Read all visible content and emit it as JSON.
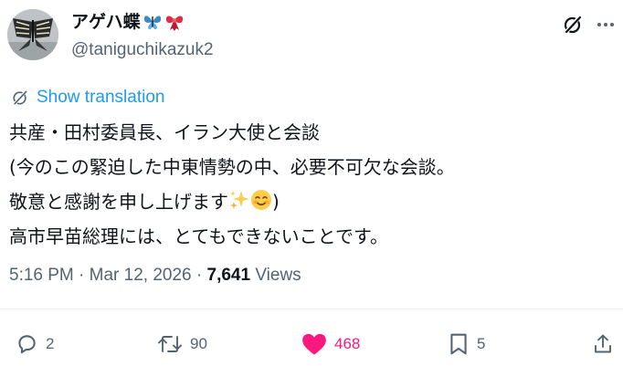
{
  "author": {
    "display_name": "アゲハ蝶",
    "name_emojis": [
      "butterfly-emoji",
      "ribbon-emoji"
    ],
    "handle": "@taniguchikazuk2"
  },
  "header_icons": [
    "grok-icon",
    "more-icon"
  ],
  "translation": {
    "label": "Show translation",
    "icon": "translate-icon"
  },
  "tweet": {
    "lines": [
      "共産・田村委員長、イラン大使と会談",
      "(今のこの緊迫した中東情勢の中、必要不可欠な会談。",
      "敬意と感謝を申し上げます",
      "高市早苗総理には、とてもできないことです。"
    ],
    "line3_emojis": [
      "sparkles-emoji",
      "smiling-face-emoji"
    ],
    "line3_suffix": ")"
  },
  "meta": {
    "time": "5:16 PM",
    "separator": "·",
    "date": "Mar 12, 2026",
    "views_count": "7,641",
    "views_label": "Views"
  },
  "actions": {
    "reply": "2",
    "retweet": "90",
    "like": "468",
    "bookmark": "5"
  },
  "colors": {
    "accent": "#1d9bf0",
    "like": "#f91880",
    "secondary_text": "#536471",
    "primary_text": "#0f1419"
  }
}
